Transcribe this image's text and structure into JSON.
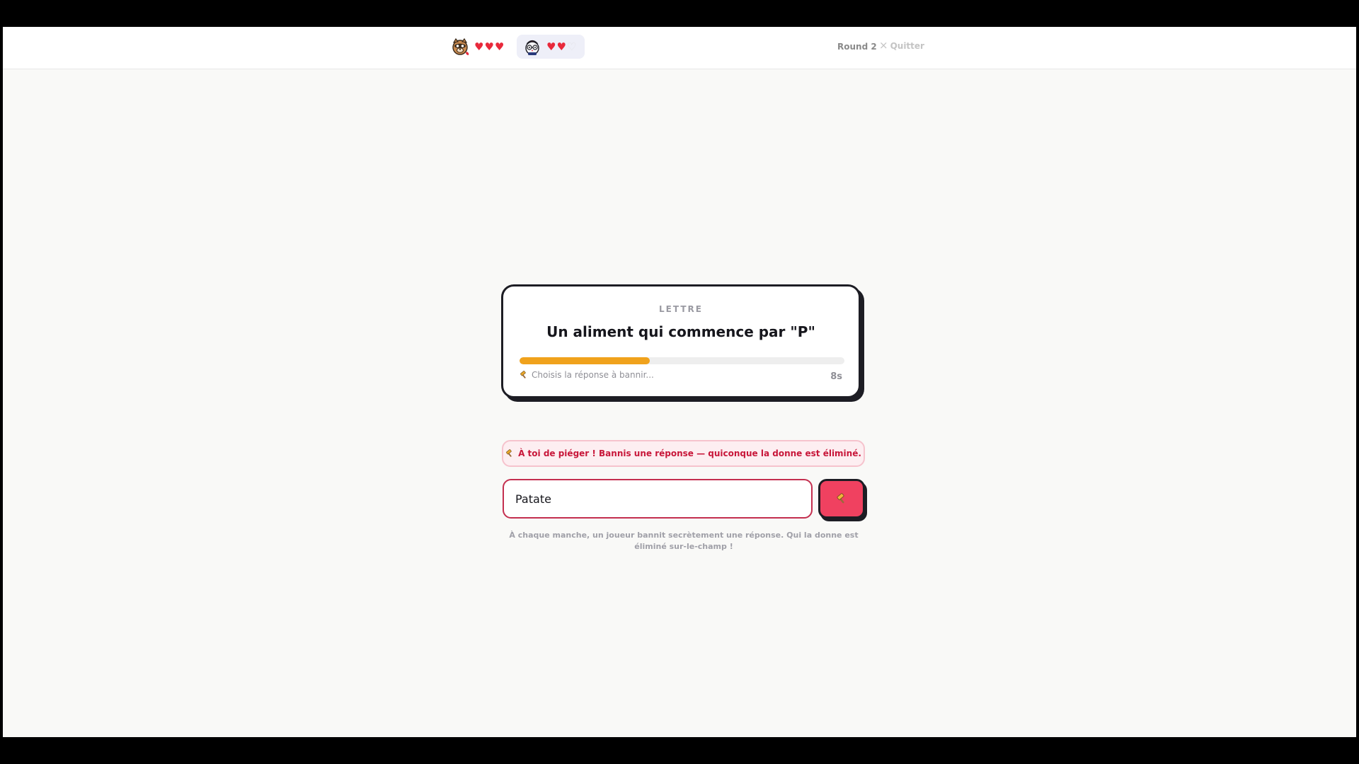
{
  "header": {
    "players": [
      {
        "avatar_icon": "raccoon-avatar-icon",
        "lives": 3,
        "max_lives": 3,
        "hearts": [
          "♥",
          "♥",
          "♥"
        ]
      },
      {
        "avatar_icon": "cat-avatar-icon",
        "lives": 2,
        "max_lives": 3,
        "hearts": [
          "♥",
          "♥",
          "♡"
        ],
        "active": true
      }
    ],
    "round_label": "Round 2",
    "quit_icon": "close-icon",
    "quit_label": "Quitter"
  },
  "card": {
    "kicker": "LETTRE",
    "question": "Un aliment qui commence par \"P\"",
    "progress_fraction": 0.4,
    "hint_icon": "hammer-icon",
    "hint": "Choisis la réponse à bannir...",
    "timer": "8s"
  },
  "banner": {
    "icon": "hammer-icon",
    "text": "À toi de piéger ! Bannis une réponse — quiconque la donne est éliminé."
  },
  "answer": {
    "value": "Patate",
    "submit_icon": "hammer-icon"
  },
  "rules_text": "À chaque manche, un joueur bannit secrètement une réponse. Qui la donne est éliminé sur-le-champ !",
  "colors": {
    "heart": "#e8293b",
    "progress": "#f0a21c",
    "accent": "#f04160",
    "banner_text": "#c8173a"
  }
}
